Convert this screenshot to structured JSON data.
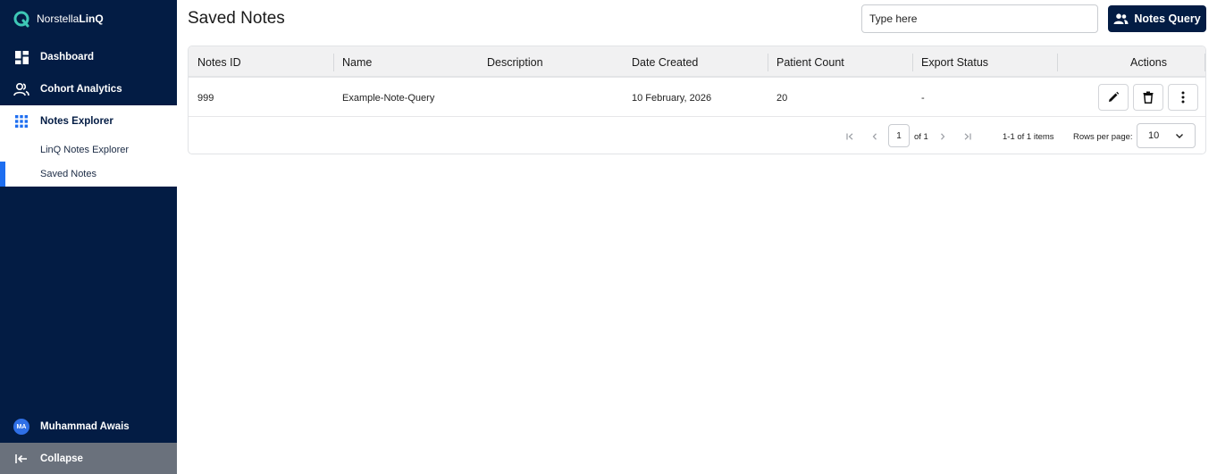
{
  "brand": {
    "name_part1": "Norstella",
    "name_part2": "LinQ"
  },
  "sidebar": {
    "items": [
      {
        "label": "Dashboard",
        "icon": "dashboard-icon"
      },
      {
        "label": "Cohort Analytics",
        "icon": "people-icon"
      },
      {
        "label": "Notes Explorer",
        "icon": "grid-icon",
        "active": true
      }
    ],
    "sub_items": [
      {
        "label": "LinQ Notes Explorer"
      },
      {
        "label": "Saved Notes",
        "selected": true
      }
    ],
    "user": {
      "initials": "MA",
      "name": "Muhammad Awais"
    },
    "collapse_label": "Collapse"
  },
  "header": {
    "title": "Saved Notes",
    "search_placeholder": "Type here",
    "primary_button": "Notes Query"
  },
  "table": {
    "columns": [
      "Notes ID",
      "Name",
      "Description",
      "Date Created",
      "Patient Count",
      "Export Status",
      "Actions"
    ],
    "rows": [
      {
        "notes_id": "999",
        "name": "Example-Note-Query",
        "description": "",
        "date_created": "10 February, 2026",
        "patient_count": "20",
        "export_status": "-"
      }
    ]
  },
  "pagination": {
    "current_page": "1",
    "of_pages": "of 1",
    "items_summary": "1-1 of 1 items",
    "rows_per_page_label": "Rows per page:",
    "rows_per_page_value": "10"
  },
  "colors": {
    "sidebar_bg": "#031c44",
    "accent": "#1e6ef0",
    "logo": "#3ec7b6"
  }
}
